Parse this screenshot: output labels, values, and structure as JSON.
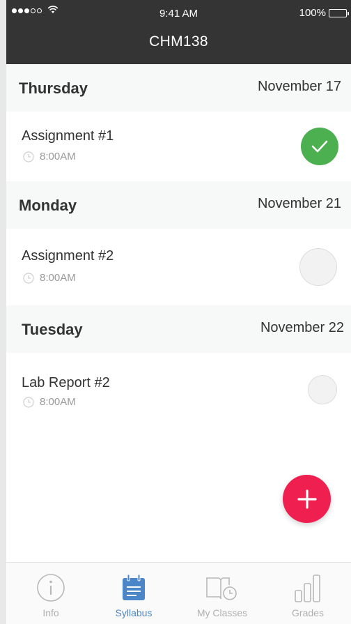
{
  "status_bar": {
    "time": "9:41 AM",
    "battery": "100%"
  },
  "header": {
    "title": "CHM138"
  },
  "days": [
    {
      "day": "Thursday",
      "date": "November 17",
      "items": [
        {
          "title": "Assignment #1",
          "time": "8:00AM",
          "done": true
        }
      ]
    },
    {
      "day": "Monday",
      "date": "November 21",
      "items": [
        {
          "title": "Assignment #2",
          "time": "8:00AM",
          "done": false
        }
      ]
    },
    {
      "day": "Tuesday",
      "date": "November 22",
      "items": [
        {
          "title": "Lab Report #2",
          "time": "8:00AM",
          "done": false
        }
      ]
    }
  ],
  "tabs": [
    {
      "label": "Info",
      "icon": "info-icon",
      "active": false
    },
    {
      "label": "Syllabus",
      "icon": "calendar-icon",
      "active": true
    },
    {
      "label": "My Classes",
      "icon": "book-clock-icon",
      "active": false
    },
    {
      "label": "Grades",
      "icon": "bar-chart-icon",
      "active": false
    }
  ],
  "colors": {
    "accent": "#4a86c8",
    "fab": "#ef1f4f",
    "done": "#4caf50",
    "header_bg": "#343434"
  }
}
